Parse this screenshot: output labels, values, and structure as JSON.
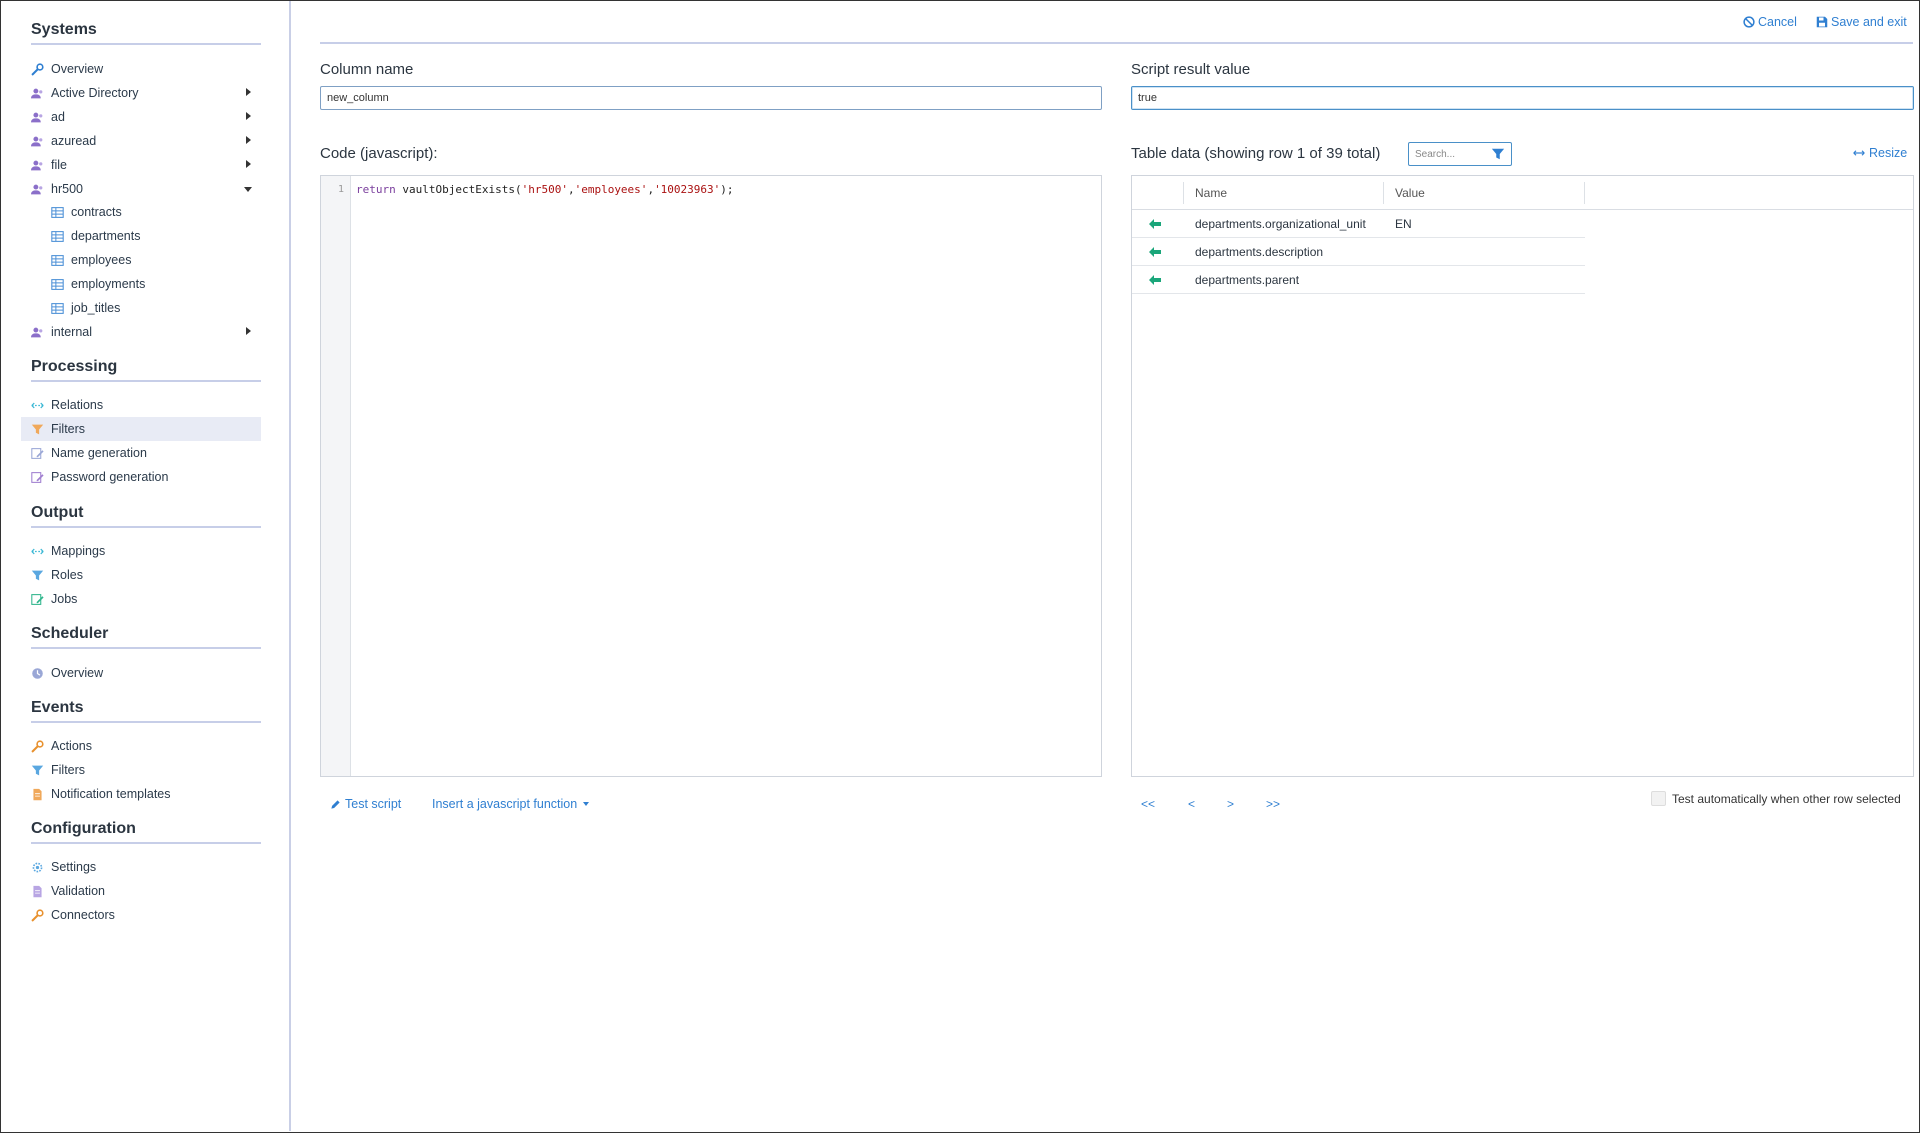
{
  "sidebar": {
    "sections": {
      "systems": "Systems",
      "processing": "Processing",
      "output": "Output",
      "scheduler": "Scheduler",
      "events": "Events",
      "configuration": "Configuration"
    },
    "systems_items": [
      "Overview",
      "Active Directory",
      "ad",
      "azuread",
      "file",
      "hr500"
    ],
    "hr500_children": [
      "contracts",
      "departments",
      "employees",
      "employments",
      "job_titles"
    ],
    "systems_after": "internal",
    "processing_items": [
      "Relations",
      "Filters",
      "Name generation",
      "Password generation"
    ],
    "output_items": [
      "Mappings",
      "Roles",
      "Jobs"
    ],
    "scheduler_items": [
      "Overview"
    ],
    "events_items": [
      "Actions",
      "Filters",
      "Notification templates"
    ],
    "configuration_items": [
      "Settings",
      "Validation",
      "Connectors"
    ]
  },
  "header": {
    "cancel_label": "Cancel",
    "save_label": "Save and exit"
  },
  "form": {
    "column_name_label": "Column name",
    "column_name_value": "new_column",
    "result_label": "Script result value",
    "result_value": "true",
    "code_label": "Code (javascript):",
    "code_line_number": "1",
    "code": {
      "kw": "return",
      "fn": " vaultObjectExists(",
      "a1": "'hr500'",
      "c1": ",",
      "a2": "'employees'",
      "c2": ",",
      "a3": "'10023963'",
      "end": ");"
    },
    "test_script_label": "Test script",
    "insert_function_label": "Insert a javascript function"
  },
  "table": {
    "title": "Table data (showing row 1 of 39 total)",
    "search_placeholder": "Search...",
    "resize_label": "Resize",
    "columns": [
      "Name",
      "Value"
    ],
    "rows": [
      {
        "name": "departments.organizational_unit",
        "value": "EN"
      },
      {
        "name": "departments.description",
        "value": ""
      },
      {
        "name": "departments.parent",
        "value": ""
      }
    ],
    "pager": {
      "first": "<<",
      "prev": "<",
      "next": ">",
      "last": ">>"
    },
    "auto_test_label": "Test automatically when other row selected"
  },
  "colors": {
    "accent": "#2f7fd1",
    "row_arrow": "#1aa67a",
    "user_icon": "#8b6fc9"
  }
}
